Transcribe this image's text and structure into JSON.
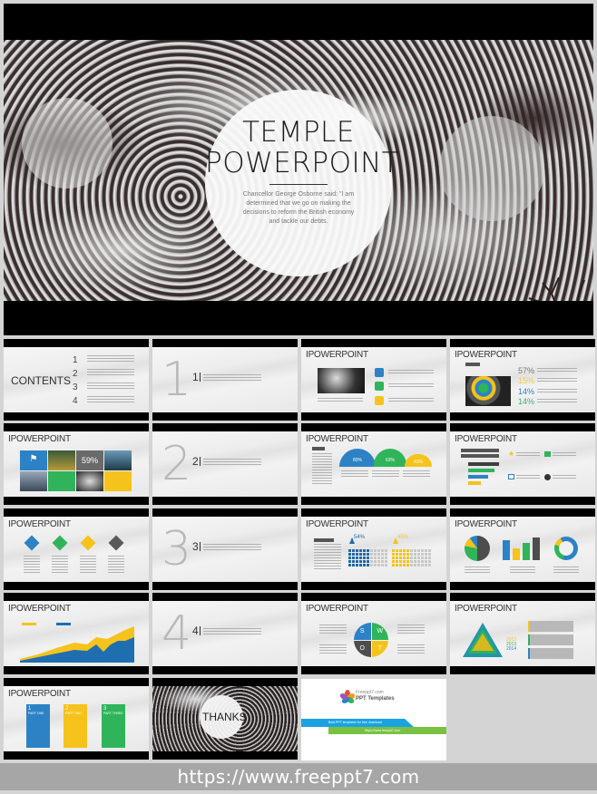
{
  "hero": {
    "title_line1": "TEMPLE",
    "title_line2": "POWERPOINT",
    "body": "Chancellor George Osborne said: \"I am determined that we go on making the decisions to reform the British economy and tackle our debts."
  },
  "slides": {
    "contents": {
      "title": "CONTENTS",
      "items": [
        "1",
        "2",
        "3",
        "4"
      ]
    },
    "section1": {
      "big": "1",
      "small": "1"
    },
    "section2": {
      "big": "2",
      "small": "2"
    },
    "section3": {
      "big": "3",
      "small": "3"
    },
    "section4": {
      "big": "4",
      "small": "4"
    },
    "slide_title": "IPOWERPOINT",
    "text_here": "TEXT HERE",
    "tiles": {
      "percent": "59%"
    },
    "stats": {
      "values": [
        "57%",
        "15%",
        "14%",
        "14%"
      ],
      "colors": [
        "#7a7a7a",
        "#f5c93a",
        "#2d82c5",
        "#3bb36a"
      ]
    },
    "semicircles": {
      "values": [
        "80%",
        "63%",
        "43%"
      ],
      "colors": [
        "#2d82c5",
        "#2fb45a",
        "#f5c31c"
      ]
    },
    "bars": {
      "values": [
        0.95,
        0.8,
        0.62,
        0.4
      ],
      "colors": [
        "#3d3d3d",
        "#2fb45a",
        "#2d82c5",
        "#f5c31c"
      ]
    },
    "diamonds": {
      "colors": [
        "#2d82c5",
        "#2fb45a",
        "#f5c31c",
        "#5a5a5a"
      ]
    },
    "people": {
      "values": [
        "54%",
        "45%"
      ],
      "colors": [
        "#2068a8",
        "#f5c31c"
      ]
    },
    "charts_trio": {
      "bar_values": [
        0.85,
        0.5,
        0.72,
        0.95
      ],
      "colors": [
        "#2d82c5",
        "#f5c31c",
        "#2fb45a",
        "#4d4d4d"
      ]
    },
    "area": {
      "labels": [
        "TEXT HERE",
        "TEXT HERE"
      ],
      "colors": [
        "#f5c31c",
        "#1f6fb0"
      ]
    },
    "swot": {
      "letters": [
        "S",
        "W",
        "O",
        "T"
      ],
      "colors": [
        "#2d82c5",
        "#2fb45a",
        "#4d4d4d",
        "#f5c31c"
      ]
    },
    "pyramid": {
      "years": [
        "2012",
        "2013",
        "2014"
      ],
      "colors": [
        "#f5c31c",
        "#2fb45a",
        "#2d82c5"
      ]
    },
    "parts": {
      "items": [
        {
          "num": "1",
          "label": "PART ONE",
          "color": "#2d82c5"
        },
        {
          "num": "2",
          "label": "PART TWO",
          "color": "#f5c31c"
        },
        {
          "num": "3",
          "label": "PART THREE",
          "color": "#2fb45a"
        }
      ]
    },
    "thanks": {
      "title": "THANKS"
    },
    "promo": {
      "brand_top": "Freeppt7.com",
      "brand_bottom": "PPT Templates",
      "tagline": "Best PPT templates for free download",
      "url": "https://www.freeppt7.com"
    }
  },
  "footer": {
    "url": "https://www.freeppt7.com"
  }
}
